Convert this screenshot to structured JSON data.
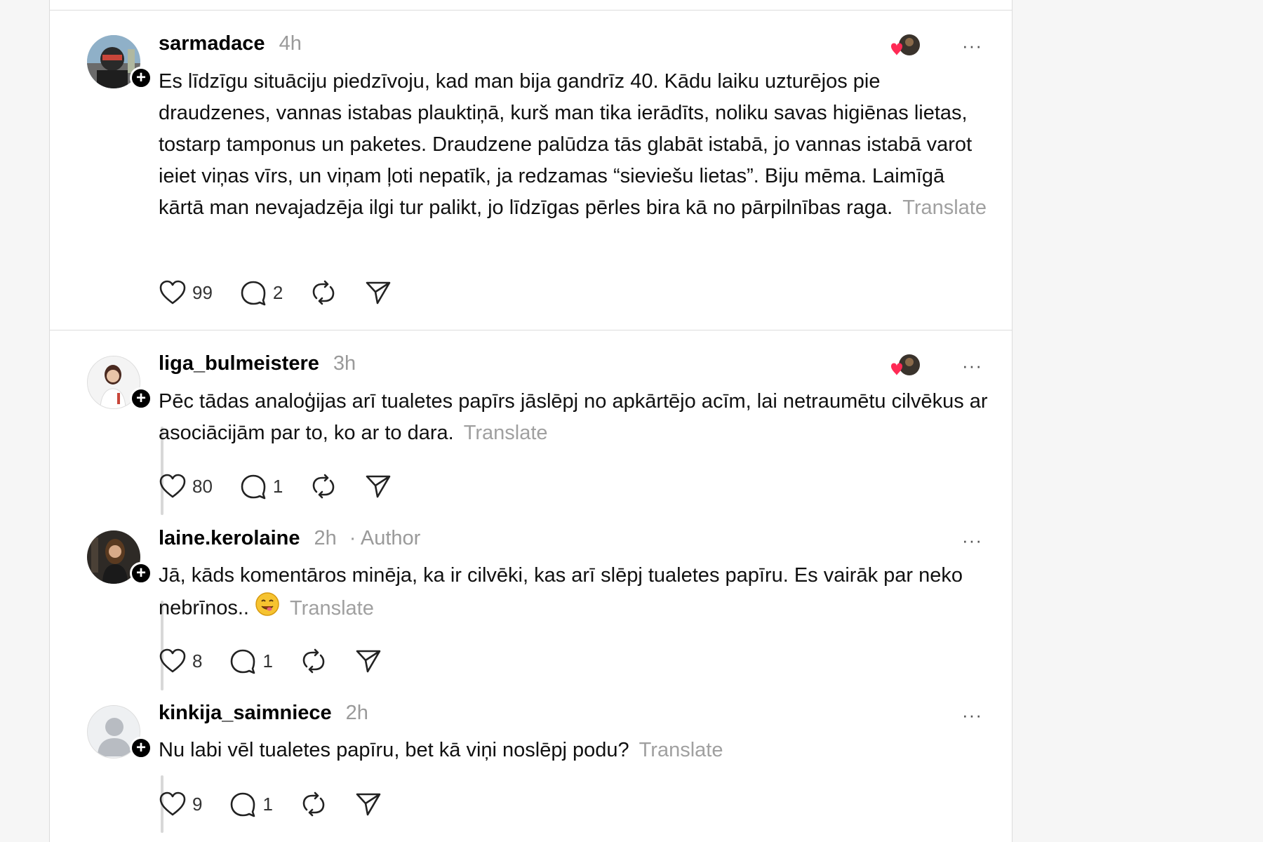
{
  "posts": [
    {
      "username": "sarmadace",
      "time": "4h",
      "author_tag": "",
      "body": "Es līdzīgu situāciju piedzīvoju, kad man bija gandrīz 40. Kādu laiku uzturējos pie draudzenes, vannas istabas plauktiņā, kurš man tika ierādīts, noliku savas higiēnas lietas, tostarp tamponus un paketes. Draudzene palūdza tās glabāt istabā, jo vannas istabā varot ieiet viņas vīrs, un viņam ļoti nepatīk, ja redzamas “sieviešu lietas”. Biju mēma. Laimīgā kārtā man nevajadzēja ilgi tur palikt, jo līdzīgas pērles bira kā no pārpilnības raga.",
      "translate": "Translate",
      "likes": "99",
      "replies": "2"
    },
    {
      "username": "liga_bulmeistere",
      "time": "3h",
      "author_tag": "",
      "body": "Pēc tādas analoģijas arī tualetes papīrs jāslēpj no apkārtējo acīm, lai netraumētu cilvēkus ar asociācijām par to, ko ar to dara.",
      "translate": "Translate",
      "likes": "80",
      "replies": "1"
    },
    {
      "username": "laine.kerolaine",
      "time": "2h",
      "author_tag": "· Author",
      "body": "Jā, kāds komentāros minēja, ka ir cilvēki, kas arī slēpj tualetes papīru. Es vairāk par neko nebrīnos..",
      "translate": "Translate",
      "likes": "8",
      "replies": "1"
    },
    {
      "username": "kinkija_saimniece",
      "time": "2h",
      "author_tag": "",
      "body": "Nu labi vēl tualetes papīru, bet kā viņi noslēpj podu?",
      "translate": "Translate",
      "likes": "9",
      "replies": "1"
    }
  ],
  "more_label": "···",
  "follow_symbol": "+",
  "colors": {
    "heart_red": "#ff2a55",
    "muted_text": "#9a9a9a",
    "divider": "#dcdcdc"
  },
  "icons": [
    "heart-icon",
    "comment-icon",
    "repost-icon",
    "share-icon",
    "more-icon",
    "follow-plus-icon",
    "smiling-face-emoji"
  ]
}
